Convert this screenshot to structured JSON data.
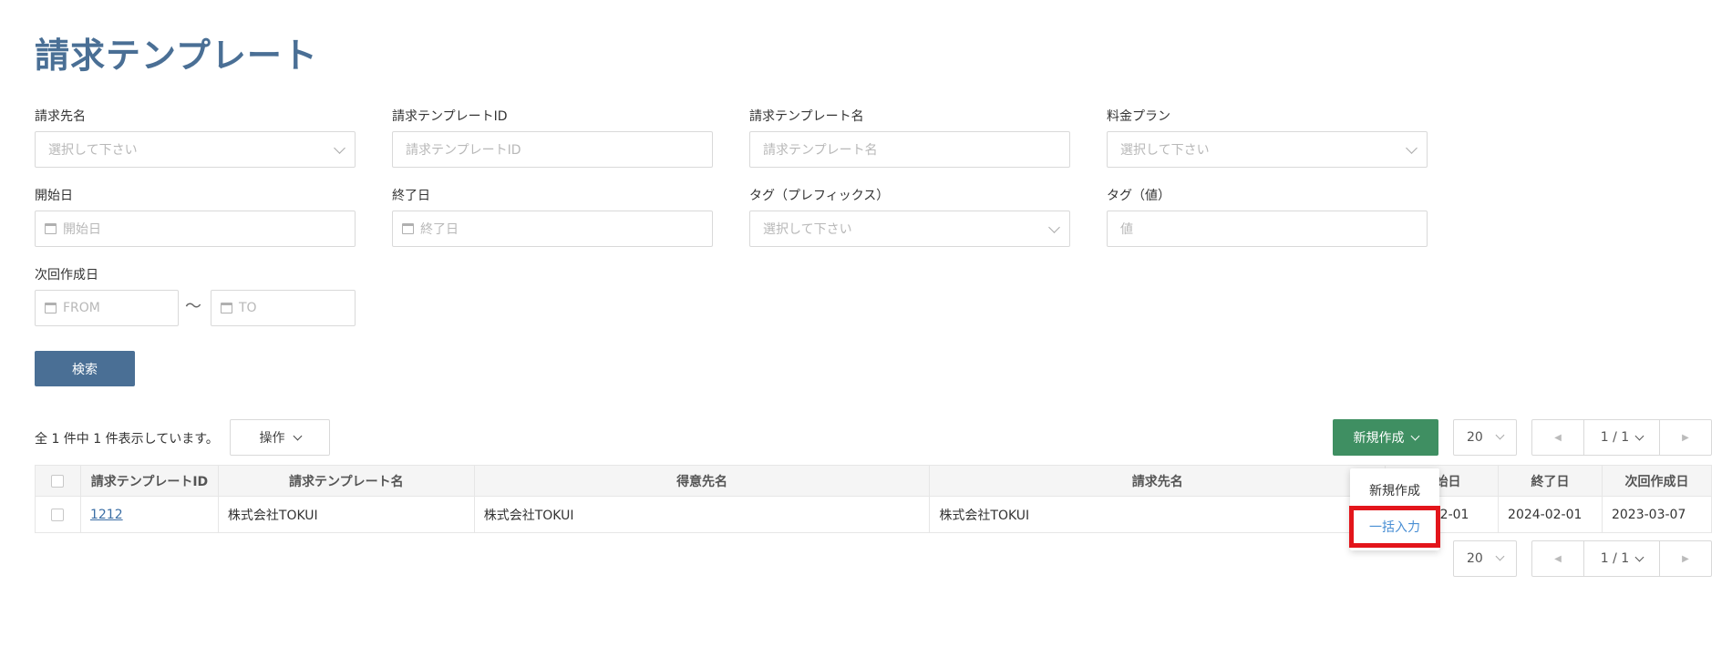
{
  "page_title": "請求テンプレート",
  "filters": {
    "billing_to": {
      "label": "請求先名",
      "placeholder": "選択して下さい"
    },
    "template_id": {
      "label": "請求テンプレートID",
      "placeholder": "請求テンプレートID"
    },
    "template_name": {
      "label": "請求テンプレート名",
      "placeholder": "請求テンプレート名"
    },
    "price_plan": {
      "label": "料金プラン",
      "placeholder": "選択して下さい"
    },
    "start_date": {
      "label": "開始日",
      "placeholder": "開始日"
    },
    "end_date": {
      "label": "終了日",
      "placeholder": "終了日"
    },
    "tag_prefix": {
      "label": "タグ（プレフィックス）",
      "placeholder": "選択して下さい"
    },
    "tag_value": {
      "label": "タグ（値）",
      "placeholder": "値"
    },
    "next_date": {
      "label": "次回作成日",
      "from_placeholder": "FROM",
      "to_placeholder": "TO",
      "separator": "〜"
    }
  },
  "search_button": "検索",
  "result_count": "全 1 件中 1 件表示しています。",
  "ops_button": "操作",
  "new_button": "新規作成",
  "per_page": "20",
  "page_indicator": "1 / 1",
  "table": {
    "headers": [
      "請求テンプレートID",
      "請求テンプレート名",
      "得意先名",
      "請求先名",
      "開始日",
      "終了日",
      "次回作成日"
    ],
    "rows": [
      {
        "id": "1212",
        "template_name": "株式会社TOKUI",
        "customer": "株式会社TOKUI",
        "billing_to": "株式会社TOKUI",
        "start": "2023-02-01",
        "end": "2024-02-01",
        "next": "2023-03-07"
      }
    ]
  },
  "dropdown": {
    "items": [
      "新規作成",
      "一括入力"
    ],
    "highlight_color": "#e3151b"
  },
  "colors": {
    "title": "#4a6f95",
    "primary": "#4a6f95",
    "success": "#3f8f62",
    "link": "#3b6ea5"
  }
}
